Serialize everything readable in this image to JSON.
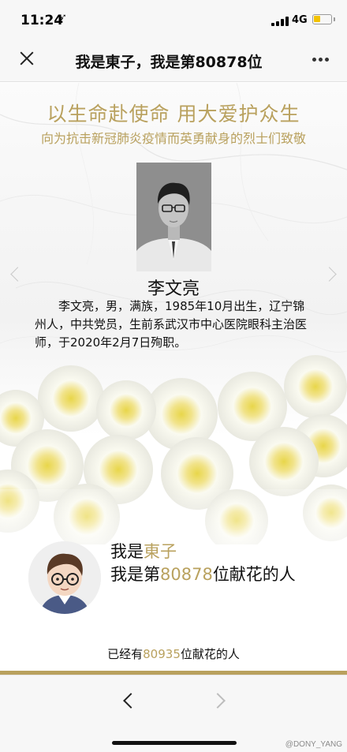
{
  "status_bar": {
    "time": "11:24",
    "location_glyph": "➶",
    "network": "4G",
    "battery_level": 0.3,
    "signal_bars": 4
  },
  "nav_bar": {
    "title": "我是東子，我是第80878位",
    "close_icon": "close-icon",
    "more_icon": "more-dots-icon"
  },
  "memorial": {
    "headline": "以生命赴使命 用大爱护众生",
    "subheadline": "向为抗击新冠肺炎疫情而英勇献身的烈士们致敬",
    "name": "李文亮",
    "bio": "李文亮，男，满族，1985年10月出生，辽宁锦州人，中共党员，生前系武汉市中心医院眼科主治医师，于2020年2月7日殉职。"
  },
  "message": {
    "prefix1": "我是",
    "username": "東子",
    "prefix2": "我是第",
    "rank": "80878",
    "suffix": "位献花的人"
  },
  "count": {
    "prefix": "已经有",
    "total": "80935",
    "suffix": "位献花的人"
  },
  "bottom_bar": {
    "watermark": "@DONY_YANG"
  },
  "colors": {
    "accent_gold": "#b9a15e",
    "bar_background": "#f7f7f7"
  }
}
